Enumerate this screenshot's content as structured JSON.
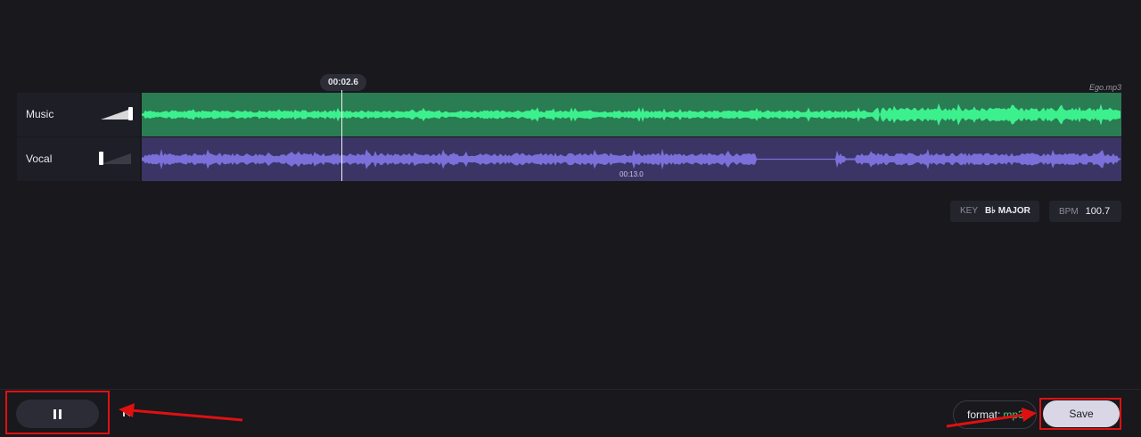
{
  "playhead": {
    "time": "00:02.6"
  },
  "file": {
    "name": "Ego.mp3"
  },
  "tracks": [
    {
      "name": "Music",
      "volume": 1.0,
      "color": "#3df08e",
      "bg": "#2a7c53"
    },
    {
      "name": "Vocal",
      "volume": 0.0,
      "color": "#7b6fd9",
      "bg": "#3b3566"
    }
  ],
  "timeline": {
    "marker": "00:13.0"
  },
  "info": {
    "key_label": "KEY",
    "key_value": "B♭ MAJOR",
    "bpm_label": "BPM",
    "bpm_value": "100.7"
  },
  "controls": {
    "format_label": "format:",
    "format_value": "mp3",
    "save_label": "Save"
  },
  "icons": [
    "pause-icon",
    "skip-back-icon",
    "volume-slider-icon"
  ],
  "colors": {
    "highlight": "#e01010",
    "accent_green": "#4ad07a"
  }
}
